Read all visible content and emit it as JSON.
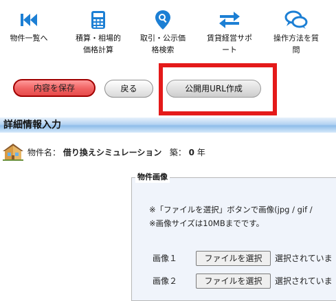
{
  "nav": {
    "items": [
      {
        "icon": "skip-back-icon",
        "label_line1": "物件一覧へ",
        "label_line2": ""
      },
      {
        "icon": "calculator-icon",
        "label_line1": "積算・相場的",
        "label_line2": "価格計算"
      },
      {
        "icon": "search-pin-icon",
        "label_line1": "取引・公示価",
        "label_line2": "格検索"
      },
      {
        "icon": "swap-arrows-icon",
        "label_line1": "賃貸経営サポ",
        "label_line2": "ート"
      },
      {
        "icon": "chat-bubbles-icon",
        "label_line1": "操作方法を質",
        "label_line2": "問"
      }
    ],
    "icon_color": "#1c7fd4"
  },
  "actions": {
    "save_label": "内容を保存",
    "back_label": "戻る",
    "url_label": "公開用URL作成",
    "highlight_color": "#e41a1a"
  },
  "section": {
    "title": "詳細情報入力"
  },
  "property": {
    "name_label": "物件名：",
    "name_value": "借り換えシミュレーション",
    "age_label": "築：",
    "age_value": "0",
    "age_unit": "年"
  },
  "image_panel": {
    "legend": "物件画像",
    "note1": "※「ファイルを選択」ボタンで画像(jpg / gif /",
    "note2": "※画像サイズは10MBまでです。",
    "rows": [
      {
        "label": "画像１",
        "button": "ファイルを選択",
        "status": "選択されていま"
      },
      {
        "label": "画像２",
        "button": "ファイルを選択",
        "status": "選択されていま"
      }
    ]
  }
}
